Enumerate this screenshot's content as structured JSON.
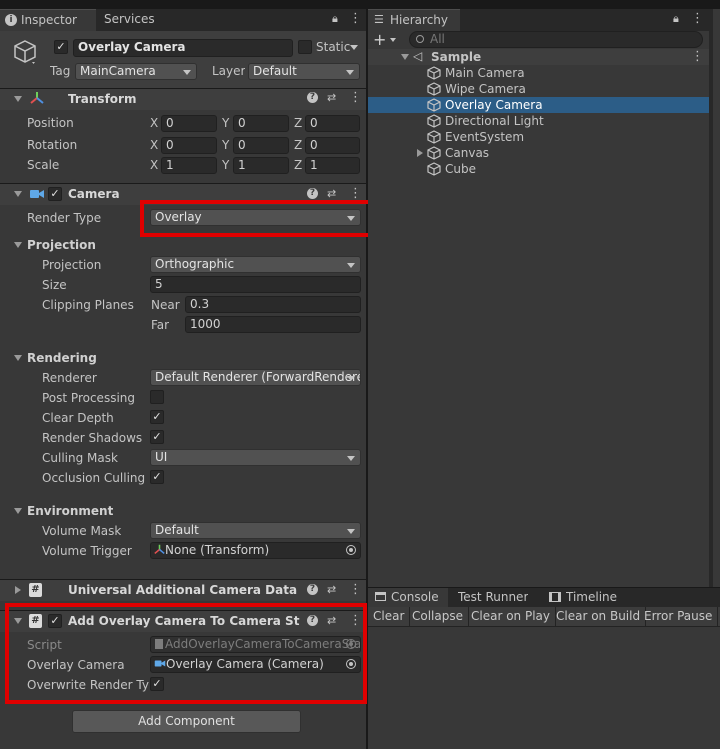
{
  "colors": {
    "accent": "#2c5d87",
    "highlight": "#e00000"
  },
  "inspector": {
    "tab_label": "Inspector",
    "services_tab": "Services",
    "object": {
      "name": "Overlay Camera",
      "static_label": "Static",
      "tag_label": "Tag",
      "tag_value": "MainCamera",
      "layer_label": "Layer",
      "layer_value": "Default"
    },
    "transform": {
      "title": "Transform",
      "position": {
        "label": "Position",
        "x": "0",
        "y": "0",
        "z": "0"
      },
      "rotation": {
        "label": "Rotation",
        "x": "0",
        "y": "0",
        "z": "0"
      },
      "scale": {
        "label": "Scale",
        "x": "1",
        "y": "1",
        "z": "1"
      },
      "axes": {
        "x": "X",
        "y": "Y",
        "z": "Z"
      }
    },
    "camera": {
      "title": "Camera",
      "render_type_label": "Render Type",
      "render_type_value": "Overlay",
      "projection_section": "Projection",
      "projection_label": "Projection",
      "projection_value": "Orthographic",
      "size_label": "Size",
      "size_value": "5",
      "clipping_label": "Clipping Planes",
      "near_label": "Near",
      "near_value": "0.3",
      "far_label": "Far",
      "far_value": "1000",
      "rendering_section": "Rendering",
      "renderer_label": "Renderer",
      "renderer_value": "Default Renderer (ForwardRenderer)",
      "post_processing_label": "Post Processing",
      "clear_depth_label": "Clear Depth",
      "render_shadows_label": "Render Shadows",
      "culling_mask_label": "Culling Mask",
      "culling_mask_value": "UI",
      "occlusion_culling_label": "Occlusion Culling",
      "environment_section": "Environment",
      "volume_mask_label": "Volume Mask",
      "volume_mask_value": "Default",
      "volume_trigger_label": "Volume Trigger",
      "volume_trigger_value": "None (Transform)"
    },
    "uacd": {
      "title": "Universal Additional Camera Data (Script)"
    },
    "overlay_stack": {
      "title": "Add Overlay Camera To Camera Stack (Script)",
      "script_label": "Script",
      "script_value": "AddOverlayCameraToCameraStack",
      "overlay_camera_label": "Overlay Camera",
      "overlay_camera_value": "Overlay Camera (Camera)",
      "overwrite_label": "Overwrite Render Type"
    },
    "add_component": "Add Component"
  },
  "hierarchy": {
    "tab_label": "Hierarchy",
    "search_placeholder": "All",
    "scene": "Sample",
    "items": [
      "Main Camera",
      "Wipe Camera",
      "Overlay Camera",
      "Directional Light",
      "EventSystem",
      "Canvas",
      "Cube"
    ]
  },
  "console": {
    "tabs": [
      "Console",
      "Test Runner",
      "Timeline"
    ],
    "toolbar": [
      "Clear",
      "Collapse",
      "Clear on Play",
      "Clear on Build",
      "Error Pause"
    ]
  }
}
